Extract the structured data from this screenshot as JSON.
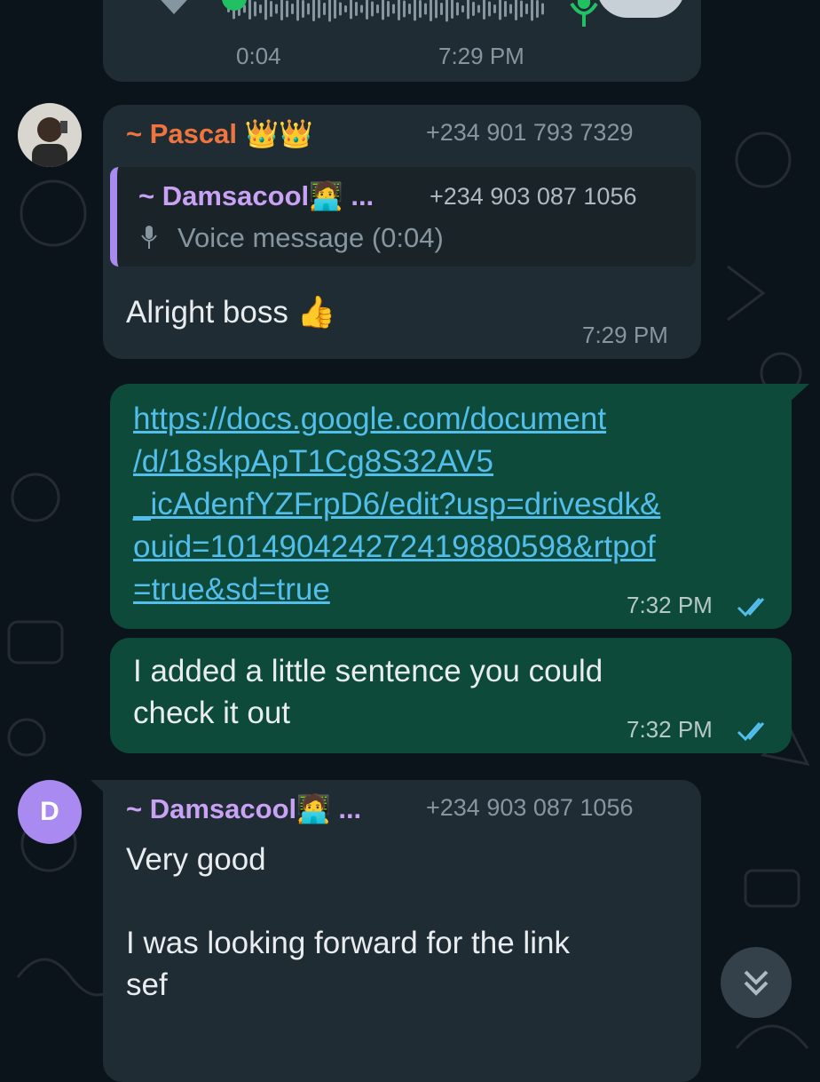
{
  "voice_top": {
    "duration": "0:04",
    "time": "7:29 PM"
  },
  "msg_pascal": {
    "sender": "~ Pascal 👑👑",
    "phone": "+234 901 793 7329",
    "quote_sender": "~ Damsacool🧑‍💻 ...",
    "quote_phone": "+234 903 087 1056",
    "quote_text": "Voice message (0:04)",
    "text": "Alright boss 👍",
    "time": "7:29 PM"
  },
  "msg_link": {
    "lines": [
      "https://docs.google.com/document",
      "/d/18skpApT1Cg8S32AV5",
      "_icAdenfYZFrpD6/edit?usp=drivesdk&",
      "ouid=101490424272419880598&rtpof",
      "=true&sd=true"
    ],
    "time": "7:32 PM"
  },
  "msg_added": {
    "lines": [
      "I added a little sentence you could",
      "check it out"
    ],
    "time": "7:32 PM"
  },
  "msg_dams": {
    "avatar_letter": "D",
    "sender": "~ Damsacool🧑‍💻 ...",
    "phone": "+234 903 087 1056",
    "lines": [
      "Very good",
      "",
      "I was looking forward for the link",
      "sef"
    ]
  },
  "colors": {
    "background": "#0b141a",
    "incoming_bubble": "#202c33",
    "outgoing_bubble": "#0d4a3a",
    "pascal_name": "#f0743e",
    "damsacool_name": "#c9a2f5",
    "link": "#53bdeb",
    "read_ticks": "#53bdeb",
    "mic_green": "#21c063"
  },
  "icons": [
    "play-icon",
    "mic-icon",
    "double-check-icon",
    "scroll-down-icon"
  ]
}
